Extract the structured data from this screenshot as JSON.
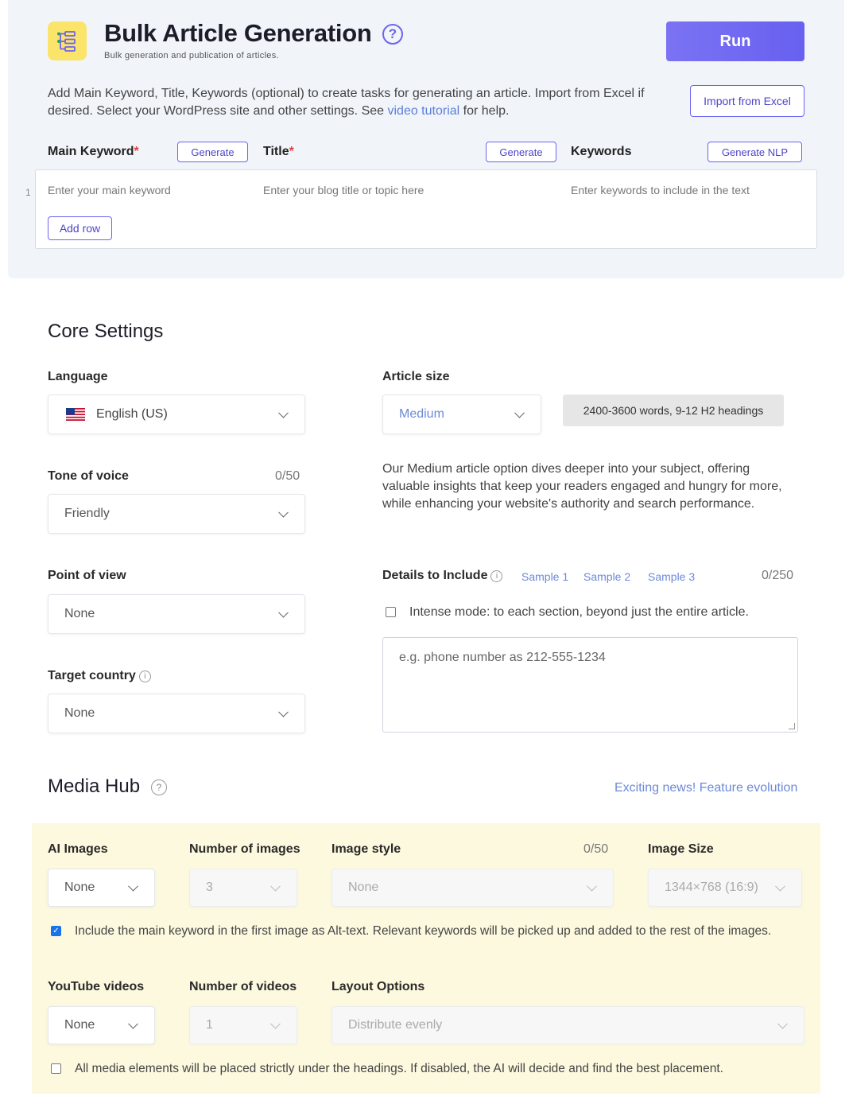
{
  "header": {
    "title": "Bulk Article Generation",
    "help_icon": "question-circle-icon",
    "subtitle": "Bulk generation and publication of articles.",
    "run_label": "Run",
    "description_pre": "Add Main Keyword, Title, Keywords (optional) to create tasks for generating an article. Import from Excel if desired. Select your WordPress site and other settings. See ",
    "description_link": "video tutorial",
    "description_post": " for help.",
    "import_label": "Import from Excel"
  },
  "task_table": {
    "main_keyword_label": "Main Keyword",
    "title_label": "Title",
    "keywords_label": "Keywords",
    "required_mark": "*",
    "generate_label": "Generate",
    "generate_nlp_label": "Generate NLP",
    "row_number": "1",
    "main_keyword_placeholder": "Enter your main keyword",
    "title_placeholder": "Enter your blog title or topic here",
    "keywords_placeholder": "Enter keywords to include in the text",
    "add_row_label": "Add row"
  },
  "core_settings": {
    "title": "Core Settings",
    "language_label": "Language",
    "language_value": "English (US)",
    "article_size_label": "Article size",
    "article_size_value": "Medium",
    "article_size_info": "2400-3600 words, 9-12 H2 headings",
    "article_size_description": "Our Medium article option dives deeper into your subject, offering valuable insights that keep your readers engaged and hungry for more, while enhancing your website's authority and search performance.",
    "tone_label": "Tone of voice",
    "tone_counter": "0/50",
    "tone_value": "Friendly",
    "pov_label": "Point of view",
    "pov_value": "None",
    "country_label": "Target country",
    "country_value": "None",
    "details_label": "Details to Include",
    "samples": [
      "Sample 1",
      "Sample 2",
      "Sample 3"
    ],
    "details_counter": "0/250",
    "intense_mode_label": "Intense mode: to each section, beyond just the entire article.",
    "details_placeholder": "e.g. phone number as 212-555-1234"
  },
  "media_hub": {
    "title": "Media Hub",
    "news_link": "Exciting news! Feature evolution",
    "ai_images_label": "AI Images",
    "ai_images_value": "None",
    "num_images_label": "Number of images",
    "num_images_value": "3",
    "image_style_label": "Image style",
    "image_style_counter": "0/50",
    "image_style_value": "None",
    "image_size_label": "Image Size",
    "image_size_value": "1344×768 (16:9)",
    "alt_text_label": "Include the main keyword in the first image as Alt-text. Relevant keywords will be picked up and added to the rest of the images.",
    "alt_text_checked": true,
    "youtube_label": "YouTube videos",
    "youtube_value": "None",
    "num_videos_label": "Number of videos",
    "num_videos_value": "1",
    "layout_label": "Layout Options",
    "layout_value": "Distribute evenly",
    "placement_label": "All media elements will be placed strictly under the headings. If disabled, the AI will decide and find the best placement.",
    "placement_checked": false
  },
  "colors": {
    "accent": "#6d63f0",
    "link": "#6b8ad8",
    "required": "#e53e3e",
    "media_panel_bg": "#fdf9df",
    "top_panel_bg": "#f1f5fa"
  }
}
